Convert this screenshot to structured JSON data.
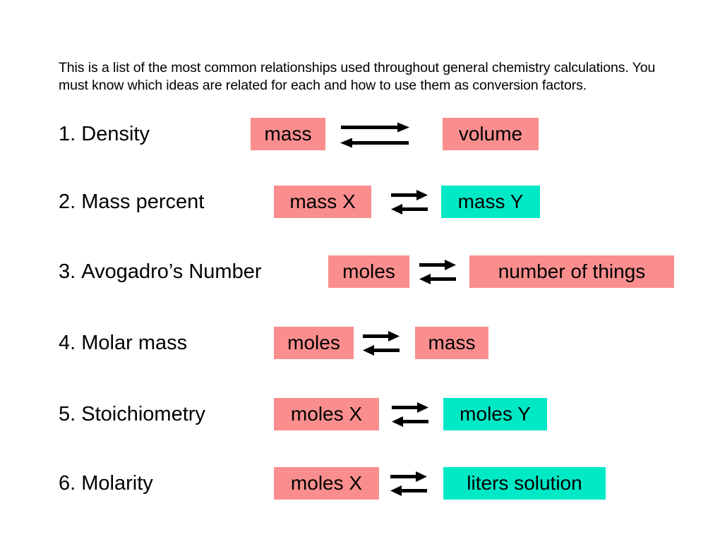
{
  "slide": {
    "background_color": "#ffffff",
    "intro_text": "This is a list of the most common relationships used throughout general chemistry calculations. You must know which ideas are related for each and how to use them as conversion factors."
  },
  "colors": {
    "pink": "#fa8e8e",
    "cyan": "#00e9c6",
    "text": "#000000",
    "arrow": "#000000"
  },
  "rows": [
    {
      "number": "1.",
      "label": "Density",
      "left_term": "mass",
      "right_term": "volume",
      "left_color": "pink",
      "right_color": "pink",
      "arrow_icon": "double-headed-equilibrium-arrows",
      "arrow_style": "wide"
    },
    {
      "number": "2.",
      "label": "Mass percent",
      "left_term": "mass X",
      "right_term": "mass Y",
      "left_color": "pink",
      "right_color": "cyan",
      "arrow_icon": "double-headed-equilibrium-arrows",
      "arrow_style": "compact"
    },
    {
      "number": "3.",
      "label": "Avogadro’s Number",
      "left_term": "moles",
      "right_term": "number of things",
      "left_color": "pink",
      "right_color": "pink",
      "arrow_icon": "double-headed-equilibrium-arrows",
      "arrow_style": "compact"
    },
    {
      "number": "4.",
      "label": "Molar mass",
      "left_term": "moles",
      "right_term": "mass",
      "left_color": "pink",
      "right_color": "pink",
      "arrow_icon": "double-headed-equilibrium-arrows",
      "arrow_style": "compact"
    },
    {
      "number": "5.",
      "label": "Stoichiometry",
      "left_term": "moles X",
      "right_term": "moles Y",
      "left_color": "pink",
      "right_color": "cyan",
      "arrow_icon": "double-headed-equilibrium-arrows",
      "arrow_style": "compact"
    },
    {
      "number": "6.",
      "label": "Molarity",
      "left_term": "moles X",
      "right_term": "liters solution",
      "left_color": "pink",
      "right_color": "cyan",
      "arrow_icon": "double-headed-equilibrium-arrows",
      "arrow_style": "compact"
    }
  ]
}
